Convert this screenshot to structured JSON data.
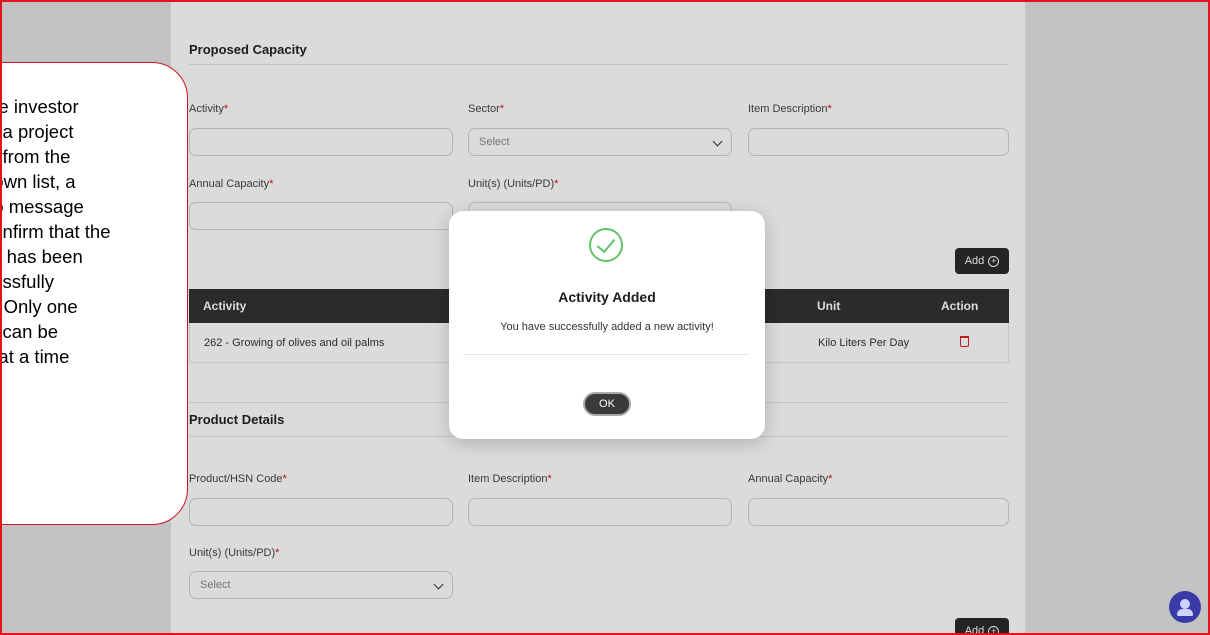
{
  "proposed": {
    "section_title": "Proposed Capacity",
    "activity_label": "Activity",
    "sector_label": "Sector",
    "sector_placeholder": "Select",
    "item_description_label": "Item Description",
    "annual_capacity_label": "Annual Capacity",
    "units_label": "Unit(s) (Units/PD)",
    "add_label": "Add",
    "required_mark": "*"
  },
  "table": {
    "headers": [
      "Activity",
      "Unit",
      "Action"
    ],
    "rows": [
      {
        "activity": "262 - Growing of olives and oil palms",
        "unit": "Kilo Liters Per Day"
      }
    ]
  },
  "product": {
    "section_title": "Product Details",
    "hsn_label": "Product/HSN Code",
    "item_description_label": "Item Description",
    "annual_capacity_label": "Annual Capacity",
    "units_label": "Unit(s) (Units/PD)",
    "units_placeholder": "Select",
    "add_label": "Add"
  },
  "modal": {
    "title": "Activity Added",
    "message": "You have successfully added a new activity!",
    "ok_label": "OK",
    "icon": "check-circle-icon",
    "accent": "#62c26a"
  },
  "callout": {
    "text": "the investor\nts a project\nty from the\ndown list, a\nup message\nconfirm that the\nity has been\ncessfully\nd. Only one\nty can be\nd at a time"
  },
  "colors": {
    "border": "#e0141d",
    "dark": "#333333",
    "delete": "#d22222"
  }
}
